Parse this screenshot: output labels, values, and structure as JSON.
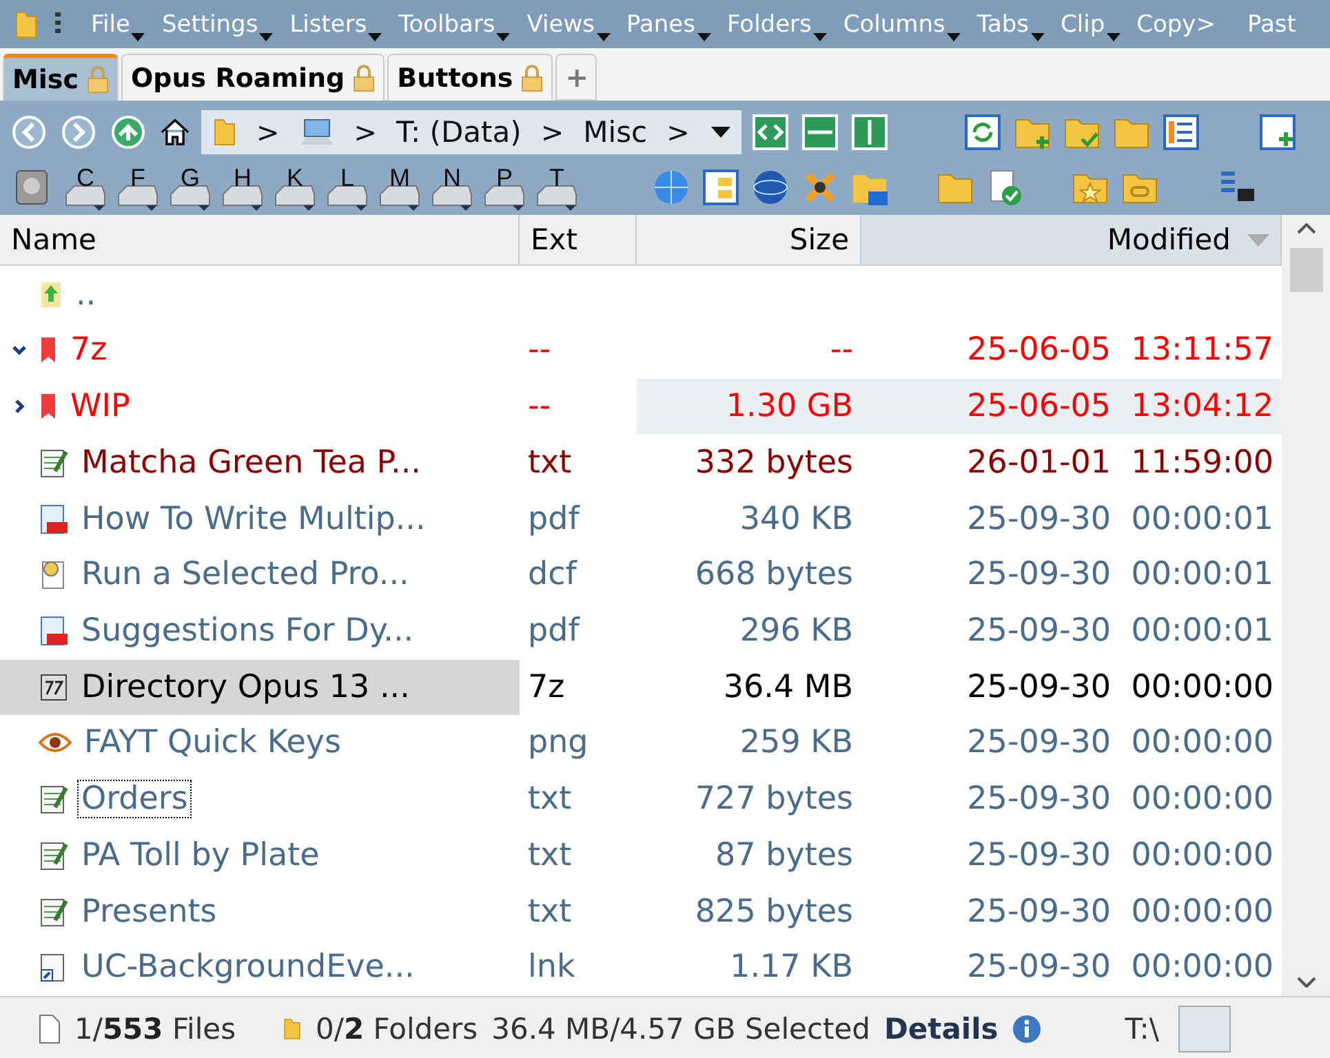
{
  "menu_bar": [
    {
      "label": "File",
      "dropdown": true
    },
    {
      "label": "Settings",
      "dropdown": true
    },
    {
      "label": "Listers",
      "dropdown": true
    },
    {
      "label": "Toolbars",
      "dropdown": true
    },
    {
      "label": "Views",
      "dropdown": true
    },
    {
      "label": "Panes",
      "dropdown": true
    },
    {
      "label": "Folders",
      "dropdown": true
    },
    {
      "label": "Columns",
      "dropdown": true
    },
    {
      "label": "Tabs",
      "dropdown": true
    },
    {
      "label": "Clip",
      "dropdown": true
    },
    {
      "label": "Copy>",
      "dropdown": false
    },
    {
      "label": "Past",
      "dropdown": false
    }
  ],
  "tabs": [
    {
      "label": "Misc",
      "selected": true,
      "locked": true
    },
    {
      "label": "Opus Roaming",
      "selected": false,
      "locked": true
    },
    {
      "label": "Buttons",
      "selected": false,
      "locked": true
    }
  ],
  "tab_add": "+",
  "breadcrumb": [
    {
      "kind": "folder"
    },
    {
      "kind": "computer"
    },
    {
      "kind": "text",
      "label": "T: (Data)"
    },
    {
      "kind": "text",
      "label": "Misc"
    }
  ],
  "separator": ">",
  "drives": [
    "C",
    "F",
    "G",
    "H",
    "K",
    "L",
    "M",
    "N",
    "P",
    "T"
  ],
  "columns": [
    {
      "label": "Name",
      "kind": "text",
      "sorted": false
    },
    {
      "label": "Ext",
      "kind": "text",
      "sorted": false
    },
    {
      "label": "Size",
      "kind": "number",
      "sorted": false
    },
    {
      "label": "Modified",
      "kind": "number",
      "sorted": true
    }
  ],
  "rows": [
    {
      "kind": "parent",
      "name": "..",
      "ext": "",
      "size": "",
      "modified": "",
      "color": "#4a6c8c",
      "selected": false,
      "focused": false
    },
    {
      "kind": "folder",
      "expanded": true,
      "name": "7z",
      "ext": "--",
      "size": "--",
      "modified": "25-06-05  13:11:57",
      "color": "#ff0000",
      "selected": false,
      "focused": false
    },
    {
      "kind": "folder",
      "expanded": false,
      "name": "WIP",
      "ext": "--",
      "size": "1.30 GB",
      "modified": "25-06-05  13:04:12",
      "color": "#ff0000",
      "selected": false,
      "focused": false,
      "highlighted": true
    },
    {
      "kind": "text",
      "name": "Matcha Green Tea P...",
      "ext": "txt",
      "size": "332 bytes",
      "modified": "26-01-01  11:59:00",
      "color": "#8b0000",
      "selected": false,
      "focused": false
    },
    {
      "kind": "pdf",
      "name": "How To Write Multip...",
      "ext": "pdf",
      "size": "340 KB",
      "modified": "25-09-30  00:00:01",
      "color": "#4a6c8c",
      "selected": false,
      "focused": false
    },
    {
      "kind": "script",
      "name": "Run a Selected Pro...",
      "ext": "dcf",
      "size": "668 bytes",
      "modified": "25-09-30  00:00:01",
      "color": "#4a6c8c",
      "selected": false,
      "focused": false
    },
    {
      "kind": "pdf",
      "name": "Suggestions For Dy...",
      "ext": "pdf",
      "size": "296 KB",
      "modified": "25-09-30  00:00:01",
      "color": "#4a6c8c",
      "selected": false,
      "focused": false
    },
    {
      "kind": "archive",
      "name": "Directory Opus 13 ...",
      "ext": "7z",
      "size": "36.4 MB",
      "modified": "25-09-30  00:00:00",
      "color": "#000000",
      "selected": true,
      "focused": false
    },
    {
      "kind": "image",
      "name": "FAYT Quick Keys",
      "ext": "png",
      "size": "259 KB",
      "modified": "25-09-30  00:00:00",
      "color": "#4a6c8c",
      "selected": false,
      "focused": false
    },
    {
      "kind": "text",
      "name": "Orders",
      "ext": "txt",
      "size": "727 bytes",
      "modified": "25-09-30  00:00:00",
      "color": "#4a6c8c",
      "selected": false,
      "focused": true
    },
    {
      "kind": "text",
      "name": "PA Toll by Plate",
      "ext": "txt",
      "size": "87 bytes",
      "modified": "25-09-30  00:00:00",
      "color": "#4a6c8c",
      "selected": false,
      "focused": false
    },
    {
      "kind": "text",
      "name": "Presents",
      "ext": "txt",
      "size": "825 bytes",
      "modified": "25-09-30  00:00:00",
      "color": "#4a6c8c",
      "selected": false,
      "focused": false
    },
    {
      "kind": "shortcut",
      "name": "UC-BackgroundEve...",
      "ext": "lnk",
      "size": "1.17 KB",
      "modified": "25-09-30  00:00:00",
      "color": "#4a6c8c",
      "selected": false,
      "focused": false
    }
  ],
  "status_bar": {
    "files": "1/**553** Files",
    "folders": "0/**2** Folders",
    "selected": "36.4 MB/4.57 GB Selected",
    "details": "Details",
    "path": "T:\\"
  }
}
